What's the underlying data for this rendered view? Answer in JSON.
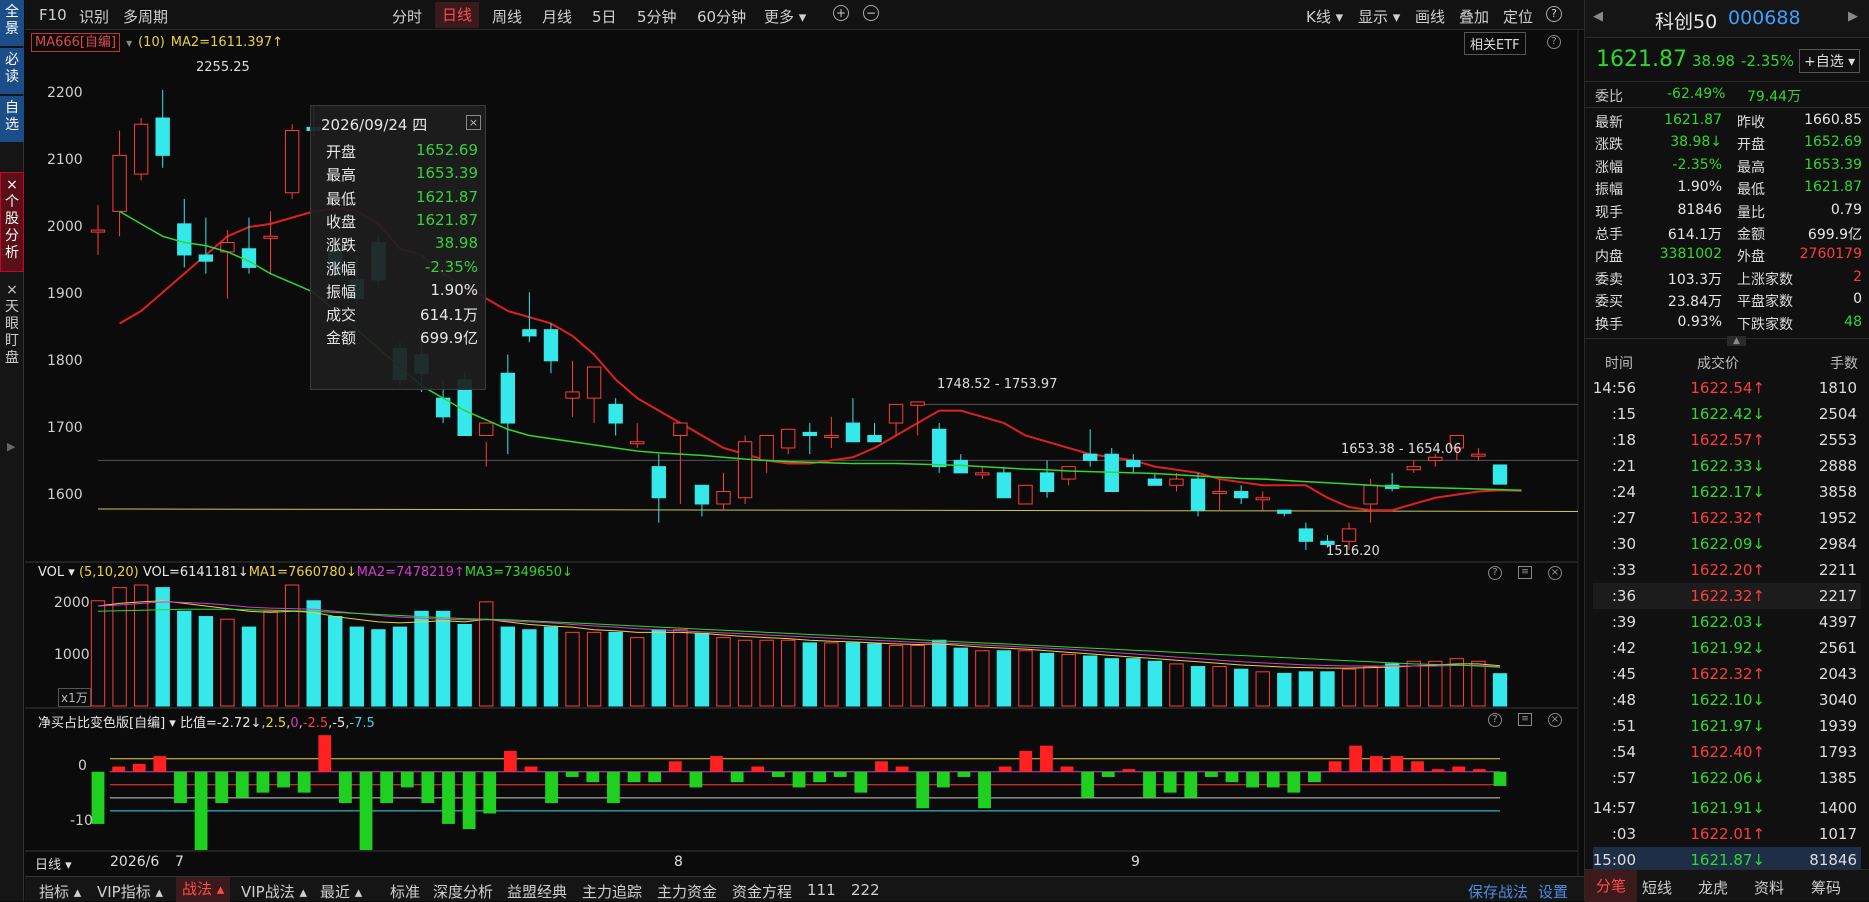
{
  "sidebar": {
    "tabs": [
      {
        "label": "全景"
      },
      {
        "label": "必读"
      },
      {
        "label": "自选"
      },
      {
        "label": "×个股分析"
      },
      {
        "label": "×天眼盯盘"
      }
    ]
  },
  "toolbar": {
    "left": [
      "F10",
      "识别",
      "多周期"
    ],
    "periods": [
      "分时",
      "日线",
      "周线",
      "月线",
      "5日",
      "5分钟",
      "60分钟",
      "更多 ▾"
    ],
    "active_period": "日线",
    "right": [
      "K线 ▾",
      "显示 ▾",
      "画线",
      "叠加",
      "定位",
      "?"
    ]
  },
  "main_chart": {
    "indicator_name": "MA666[自编]",
    "param": "(10)",
    "ma2_label": "MA2=1611.397↑",
    "etf_button": "相关ETF",
    "y_labels": [
      "2200",
      "2100",
      "2000",
      "1900",
      "1800",
      "1700",
      "1600"
    ],
    "annotations": {
      "high": "2255.25",
      "low": "1516.20",
      "range1": "1748.52 - 1753.97",
      "range2": "1653.38 - 1654.06"
    }
  },
  "tooltip": {
    "date": "2026/09/24 四",
    "rows": [
      {
        "label": "开盘",
        "value": "1652.69",
        "color": "#35d13a"
      },
      {
        "label": "最高",
        "value": "1653.39",
        "color": "#35d13a"
      },
      {
        "label": "最低",
        "value": "1621.87",
        "color": "#35d13a"
      },
      {
        "label": "收盘",
        "value": "1621.87",
        "color": "#35d13a"
      },
      {
        "label": "涨跌",
        "value": "38.98",
        "color": "#35d13a"
      },
      {
        "label": "涨幅",
        "value": "-2.35%",
        "color": "#35d13a"
      },
      {
        "label": "振幅",
        "value": "1.90%",
        "color": "#e6e6e6"
      },
      {
        "label": "成交",
        "value": "614.1万",
        "color": "#e6e6e6"
      },
      {
        "label": "金额",
        "value": "699.9亿",
        "color": "#e6e6e6"
      }
    ]
  },
  "volume_panel": {
    "title": "VOL ▾",
    "params": "(5,10,20)",
    "vol_label": "VOL=6141181↓",
    "ma1_label": "MA1=7660780↓",
    "ma2_label": "MA2=7478219↑",
    "ma3_label": "MA3=7349650↓",
    "y_labels": [
      "2000",
      "1000"
    ],
    "unit": "x1万"
  },
  "ratio_panel": {
    "title": "净买占比变色版[自编] ▾",
    "ratio_label": "比值=-2.72↓",
    "levels": [
      "2.5",
      "0",
      "-2.5",
      "-5",
      "-7.5"
    ],
    "y_labels": [
      "0",
      "-10"
    ]
  },
  "x_axis": {
    "period_label": "日线 ▾",
    "labels": [
      "2026/6",
      "7",
      "8",
      "9"
    ]
  },
  "candle_data": {
    "type": "candlestick",
    "y_range": [
      1500,
      2300
    ],
    "ohlc": [
      [
        2030,
        2070,
        1990,
        2030
      ],
      [
        2060,
        2190,
        2020,
        2150
      ],
      [
        2120,
        2210,
        2110,
        2200
      ],
      [
        2210,
        2255.25,
        2130,
        2150
      ],
      [
        2040,
        2080,
        1970,
        1990
      ],
      [
        1990,
        2050,
        1960,
        1980
      ],
      [
        1995,
        2030,
        1920,
        2010
      ],
      [
        2000,
        2050,
        1960,
        1970
      ],
      [
        2020,
        2060,
        1960,
        2020
      ],
      [
        2090,
        2200,
        2080,
        2190
      ],
      [
        2195,
        2230,
        2180,
        2190
      ],
      [
        2000,
        2010,
        1960,
        1960
      ],
      [
        1950,
        1990,
        1910,
        1920
      ],
      [
        2010,
        2020,
        1940,
        1950
      ],
      [
        1840,
        1850,
        1780,
        1790
      ],
      [
        1830,
        1860,
        1770,
        1800
      ],
      [
        1760,
        1790,
        1720,
        1730
      ],
      [
        1790,
        1800,
        1710,
        1700
      ],
      [
        1700,
        1690,
        1650,
        1720
      ],
      [
        1800,
        1830,
        1670,
        1720
      ],
      [
        1870,
        1930,
        1850,
        1860
      ],
      [
        1870,
        1880,
        1800,
        1820
      ],
      [
        1760,
        1820,
        1730,
        1770
      ],
      [
        1760,
        1800,
        1720,
        1810
      ],
      [
        1750,
        1760,
        1700,
        1720
      ],
      [
        1690,
        1720,
        1680,
        1690
      ],
      [
        1650,
        1670,
        1560,
        1600
      ],
      [
        1700,
        1720,
        1590,
        1720
      ],
      [
        1620,
        1620,
        1570,
        1590
      ],
      [
        1590,
        1640,
        1580,
        1610
      ],
      [
        1600,
        1700,
        1590,
        1690
      ],
      [
        1660,
        1690,
        1640,
        1700
      ],
      [
        1680,
        1710,
        1670,
        1710
      ],
      [
        1705,
        1720,
        1670,
        1700
      ],
      [
        1700,
        1730,
        1680,
        1700
      ],
      [
        1720,
        1760,
        1700,
        1690
      ],
      [
        1700,
        1720,
        1690,
        1690
      ],
      [
        1720,
        1740,
        1700,
        1750
      ],
      [
        1748.52,
        1753.97,
        1700,
        1753.97
      ],
      [
        1710,
        1720,
        1640,
        1650
      ],
      [
        1660,
        1670,
        1640,
        1640
      ],
      [
        1640,
        1650,
        1630,
        1640
      ],
      [
        1640,
        1650,
        1600,
        1600
      ],
      [
        1590,
        1620,
        1590,
        1620
      ],
      [
        1640,
        1660,
        1600,
        1610
      ],
      [
        1630,
        1650,
        1620,
        1650
      ],
      [
        1670,
        1710,
        1650,
        1660
      ],
      [
        1670,
        1680,
        1610,
        1610
      ],
      [
        1660,
        1670,
        1640,
        1650
      ],
      [
        1630,
        1640,
        1620,
        1620
      ],
      [
        1620,
        1640,
        1610,
        1630
      ],
      [
        1630,
        1640,
        1570,
        1580
      ],
      [
        1610,
        1630,
        1580,
        1610
      ],
      [
        1610,
        1620,
        1590,
        1600
      ],
      [
        1600,
        1610,
        1580,
        1600
      ],
      [
        1580,
        1580,
        1570,
        1575
      ],
      [
        1550,
        1560,
        1516.2,
        1530
      ],
      [
        1530,
        1540,
        1520,
        1525
      ],
      [
        1530,
        1560,
        1516.2,
        1550
      ],
      [
        1590,
        1630,
        1560,
        1620
      ],
      [
        1620,
        1640,
        1610,
        1615
      ],
      [
        1645,
        1660,
        1640,
        1650
      ],
      [
        1660,
        1670,
        1650,
        1665
      ],
      [
        1680,
        1700,
        1660,
        1700
      ],
      [
        1670,
        1680,
        1660,
        1670
      ],
      [
        1652.69,
        1653.39,
        1621.87,
        1621.87
      ]
    ],
    "ma_short": [
      1880,
      1900,
      1930,
      1960,
      1990,
      2020,
      2035,
      2040,
      2050,
      2060,
      2065,
      2060,
      2040,
      2000,
      1990,
      1960,
      1940,
      1920,
      1900,
      1890,
      1880,
      1860,
      1830,
      1790,
      1760,
      1740,
      1720,
      1700,
      1680,
      1670,
      1660,
      1655,
      1655,
      1660,
      1665,
      1680,
      1700,
      1720,
      1740,
      1740,
      1730,
      1720,
      1700,
      1690,
      1680,
      1670,
      1665,
      1660,
      1650,
      1645,
      1640,
      1630,
      1625,
      1620,
      1620,
      1620,
      1600,
      1585,
      1580,
      1580,
      1590,
      1600,
      1605,
      1610,
      1612,
      1611
    ],
    "ma_long": [
      2060,
      2040,
      2020,
      2010,
      2005,
      1995,
      1980,
      1960,
      1945,
      1930,
      1900,
      1870,
      1840,
      1810,
      1780,
      1760,
      1740,
      1725,
      1710,
      1700,
      1695,
      1690,
      1685,
      1680,
      1675,
      1672,
      1670,
      1668,
      1665,
      1662,
      1660,
      1658,
      1657,
      1656,
      1655,
      1655,
      1655,
      1654,
      1653,
      1652,
      1650,
      1648,
      1646,
      1645,
      1643,
      1642,
      1641,
      1640,
      1639,
      1637,
      1635,
      1633,
      1631,
      1630,
      1628,
      1626,
      1624,
      1622,
      1620,
      1618,
      1617,
      1616,
      1615,
      1614,
      1613,
      1612
    ]
  },
  "volume_data": {
    "values": [
      2000,
      2250,
      2300,
      2250,
      1800,
      1700,
      1650,
      1500,
      1800,
      2300,
      2000,
      1700,
      1500,
      1450,
      1500,
      1800,
      1800,
      1550,
      1980,
      1500,
      1450,
      1500,
      1400,
      1400,
      1400,
      1300,
      1450,
      1450,
      1380,
      1300,
      1250,
      1250,
      1250,
      1200,
      1200,
      1200,
      1180,
      1150,
      1150,
      1250,
      1100,
      1050,
      1050,
      1050,
      1000,
      980,
      950,
      900,
      900,
      850,
      800,
      750,
      750,
      700,
      650,
      620,
      650,
      650,
      700,
      750,
      800,
      850,
      850,
      900,
      850,
      614
    ],
    "ma1": [
      1900,
      1950,
      1980,
      2000,
      1950,
      1900,
      1850,
      1800,
      1780,
      1800,
      1780,
      1700,
      1650,
      1600,
      1580,
      1600,
      1620,
      1600,
      1650,
      1600,
      1550,
      1520,
      1500,
      1450,
      1430,
      1400,
      1400,
      1400,
      1380,
      1350,
      1320,
      1300,
      1280,
      1250,
      1230,
      1220,
      1200,
      1180,
      1170,
      1180,
      1150,
      1120,
      1100,
      1080,
      1050,
      1020,
      990,
      960,
      930,
      900,
      870,
      840,
      810,
      780,
      760,
      740,
      730,
      720,
      720,
      730,
      740,
      760,
      780,
      800,
      800,
      766
    ],
    "ma2": [
      1900,
      1920,
      1950,
      1980,
      1970,
      1950,
      1920,
      1880,
      1860,
      1850,
      1840,
      1800,
      1760,
      1720,
      1690,
      1670,
      1650,
      1640,
      1640,
      1620,
      1600,
      1580,
      1550,
      1520,
      1500,
      1470,
      1450,
      1430,
      1410,
      1390,
      1370,
      1350,
      1330,
      1310,
      1290,
      1270,
      1250,
      1230,
      1210,
      1200,
      1180,
      1160,
      1140,
      1120,
      1100,
      1080,
      1050,
      1020,
      990,
      960,
      930,
      900,
      870,
      840,
      820,
      800,
      780,
      770,
      760,
      760,
      760,
      760,
      760,
      770,
      770,
      748
    ],
    "ma3": [
      1800,
      1810,
      1820,
      1830,
      1840,
      1840,
      1840,
      1830,
      1820,
      1810,
      1800,
      1780,
      1760,
      1740,
      1720,
      1700,
      1680,
      1660,
      1650,
      1640,
      1620,
      1600,
      1580,
      1560,
      1540,
      1520,
      1500,
      1480,
      1460,
      1440,
      1420,
      1400,
      1380,
      1360,
      1340,
      1320,
      1300,
      1280,
      1260,
      1240,
      1220,
      1200,
      1180,
      1160,
      1140,
      1120,
      1100,
      1080,
      1060,
      1040,
      1020,
      1000,
      980,
      960,
      940,
      920,
      900,
      880,
      860,
      840,
      820,
      800,
      790,
      780,
      760,
      735
    ]
  },
  "ratio_data": {
    "values": [
      -10,
      1,
      1.5,
      3,
      -6,
      -15,
      -6,
      -5,
      -4,
      -3,
      -4,
      7,
      -6,
      -15,
      -6,
      -3,
      -6,
      -10,
      -11,
      -8,
      4,
      1,
      -6,
      -1,
      -2,
      -6,
      -2,
      -2,
      2,
      -3,
      3,
      -2,
      1,
      -1,
      -3,
      -2,
      -1,
      -4,
      2,
      1,
      -7,
      -3,
      -1,
      -7,
      1,
      4,
      5,
      1,
      -5,
      -1,
      0.5,
      -5,
      -4,
      -5,
      -1,
      -2,
      -3,
      -3,
      -4,
      -2,
      2,
      5,
      3,
      3,
      2,
      0.5,
      1,
      0.5,
      -2.72
    ],
    "y_range": [
      -15,
      8
    ]
  },
  "right_panel": {
    "name": "科创50",
    "code": "000688",
    "price": "1621.87",
    "change": "38.98",
    "change_pct": "-2.35%",
    "watch_button": "+自选 ▾",
    "weibi_label": "委比",
    "weibi": "-62.49%",
    "weibi_diff": "79.44万",
    "stats": [
      {
        "l1": "最新",
        "v1": "1621.87",
        "c1": "#2fd72f",
        "l2": "昨收",
        "v2": "1660.85",
        "c2": "#e6e6e6"
      },
      {
        "l1": "涨跌",
        "v1": "38.98↓",
        "c1": "#2fd72f",
        "l2": "开盘",
        "v2": "1652.69",
        "c2": "#2fd72f"
      },
      {
        "l1": "涨幅",
        "v1": "-2.35%",
        "c1": "#2fd72f",
        "l2": "最高",
        "v2": "1653.39",
        "c2": "#2fd72f"
      },
      {
        "l1": "振幅",
        "v1": "1.90%",
        "c1": "#e6e6e6",
        "l2": "最低",
        "v2": "1621.87",
        "c2": "#2fd72f"
      },
      {
        "l1": "现手",
        "v1": "81846",
        "c1": "#e6e6e6",
        "l2": "量比",
        "v2": "0.79",
        "c2": "#e6e6e6"
      },
      {
        "l1": "总手",
        "v1": "614.1万",
        "c1": "#e6e6e6",
        "l2": "金额",
        "v2": "699.9亿",
        "c2": "#e6e6e6"
      },
      {
        "l1": "内盘",
        "v1": "3381002",
        "c1": "#2fd72f",
        "l2": "外盘",
        "v2": "2760179",
        "c2": "#ff3b3b"
      },
      {
        "l1": "委卖",
        "v1": "103.3万",
        "c1": "#e6e6e6",
        "l2": "上涨家数",
        "v2": "2",
        "c2": "#ff3b3b"
      },
      {
        "l1": "委买",
        "v1": "23.84万",
        "c1": "#e6e6e6",
        "l2": "平盘家数",
        "v2": "0",
        "c2": "#e6e6e6"
      },
      {
        "l1": "换手",
        "v1": "0.93%",
        "c1": "#e6e6e6",
        "l2": "下跌家数",
        "v2": "48",
        "c2": "#2fd72f"
      }
    ],
    "trade_header": [
      "时间",
      "成交价",
      "手数"
    ],
    "trades": [
      {
        "time": "14:56",
        "price": "1622.54↑",
        "pc": "#ff3b3b",
        "vol": "1810"
      },
      {
        "time": ":15",
        "price": "1622.42↓",
        "pc": "#2fd72f",
        "vol": "2504"
      },
      {
        "time": ":18",
        "price": "1622.57↑",
        "pc": "#ff3b3b",
        "vol": "2553"
      },
      {
        "time": ":21",
        "price": "1622.33↓",
        "pc": "#2fd72f",
        "vol": "2888"
      },
      {
        "time": ":24",
        "price": "1622.17↓",
        "pc": "#2fd72f",
        "vol": "3858"
      },
      {
        "time": ":27",
        "price": "1622.32↑",
        "pc": "#ff3b3b",
        "vol": "1952"
      },
      {
        "time": ":30",
        "price": "1622.09↓",
        "pc": "#2fd72f",
        "vol": "2984"
      },
      {
        "time": ":33",
        "price": "1622.20↑",
        "pc": "#ff3b3b",
        "vol": "2211"
      },
      {
        "time": ":36",
        "price": "1622.32↑",
        "pc": "#ff3b3b",
        "vol": "2217"
      },
      {
        "time": ":39",
        "price": "1622.03↓",
        "pc": "#2fd72f",
        "vol": "4397"
      },
      {
        "time": ":42",
        "price": "1621.92↓",
        "pc": "#2fd72f",
        "vol": "2561"
      },
      {
        "time": ":45",
        "price": "1622.32↑",
        "pc": "#ff3b3b",
        "vol": "2043"
      },
      {
        "time": ":48",
        "price": "1622.10↓",
        "pc": "#2fd72f",
        "vol": "3040"
      },
      {
        "time": ":51",
        "price": "1621.97↓",
        "pc": "#2fd72f",
        "vol": "1939"
      },
      {
        "time": ":54",
        "price": "1622.40↑",
        "pc": "#ff3b3b",
        "vol": "1793"
      },
      {
        "time": ":57",
        "price": "1622.06↓",
        "pc": "#2fd72f",
        "vol": "1385"
      },
      {
        "time": "14:57",
        "price": "1621.91↓",
        "pc": "#2fd72f",
        "vol": "1400"
      },
      {
        "time": ":03",
        "price": "1622.01↑",
        "pc": "#ff3b3b",
        "vol": "1017"
      },
      {
        "time": "15:00",
        "price": "1621.87↓",
        "pc": "#2fd72f",
        "vol": "81846"
      }
    ],
    "bottom_tabs": [
      "分笔",
      "短线",
      "龙虎",
      "资料",
      "筹码"
    ],
    "active_tab": "分笔"
  },
  "bottom_bar": {
    "menus": [
      "指标 ▴",
      "VIP指标 ▴",
      "战法 ▴",
      "VIP战法 ▴",
      "最近 ▴"
    ],
    "active_menu": "战法 ▴",
    "items": [
      "标准",
      "深度分析",
      "益盟经典",
      "主力追踪",
      "主力资金",
      "资金方程",
      "111",
      "222"
    ],
    "right": [
      "保存战法",
      "设置"
    ]
  },
  "colors": {
    "up": "#ff3b3b",
    "down": "#35e8ea",
    "ma_short": "#e02020",
    "ma_long": "#2fd72f",
    "accent_blue": "#1b4d88"
  }
}
